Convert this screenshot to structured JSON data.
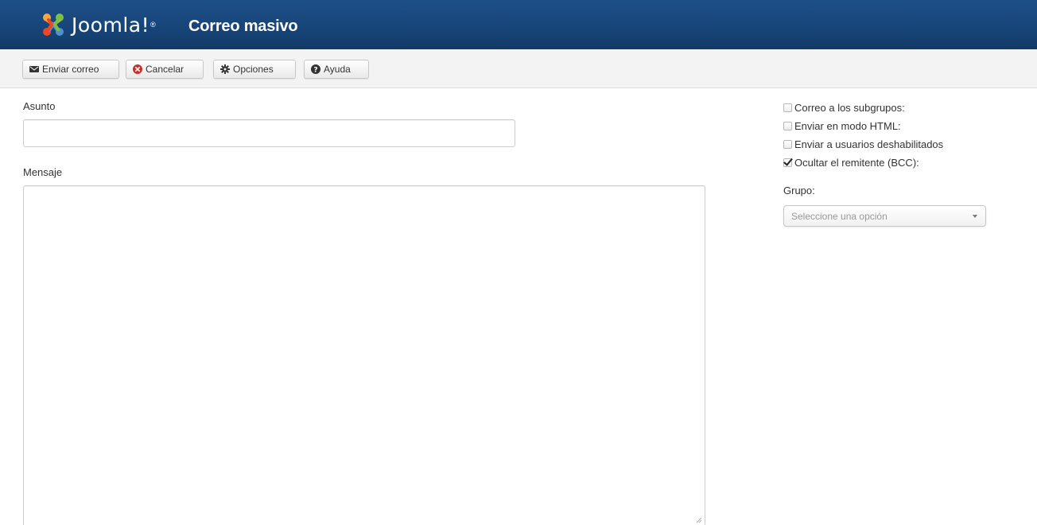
{
  "header": {
    "brand": "Joomla!",
    "brand_text": "Joomla",
    "brand_mark": "!",
    "brand_sup": "®",
    "page_title": "Correo masivo",
    "colors": {
      "bar": "#17457a"
    }
  },
  "toolbar": {
    "send_label": "Enviar correo",
    "send_icon": "envelope-icon",
    "cancel_label": "Cancelar",
    "cancel_icon": "cancel-circle-icon",
    "options_label": "Opciones",
    "options_icon": "gear-icon",
    "help_label": "Ayuda",
    "help_icon": "question-circle-icon"
  },
  "form": {
    "subject_label": "Asunto",
    "subject_value": "",
    "message_label": "Mensaje",
    "message_value": ""
  },
  "options": {
    "subgroups_label": "Correo a los subgrupos:",
    "subgroups_checked": false,
    "html_label": "Enviar en modo HTML:",
    "html_checked": false,
    "disabled_label": "Enviar a usuarios deshabilitados",
    "disabled_checked": false,
    "bcc_label": "Ocultar el remitente (BCC):",
    "bcc_checked": true,
    "group_label": "Grupo:",
    "group_placeholder": "Seleccione una opción"
  }
}
